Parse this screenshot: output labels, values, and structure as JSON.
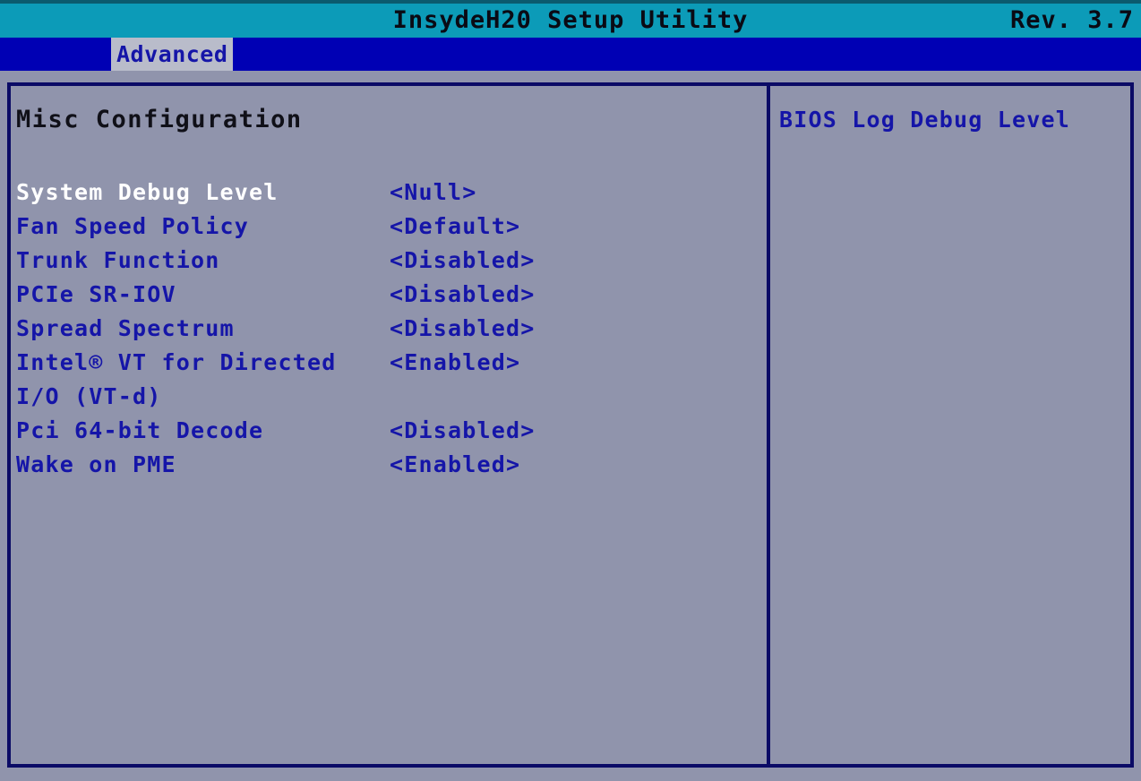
{
  "window": {
    "title": "InsydeH20 Setup Utility",
    "revision": "Rev. 3.7"
  },
  "colors": {
    "title_bar": "#0c9bb8",
    "menu_bar": "#0000b4",
    "panel_background": "#9094ac",
    "frame_border": "#0b0b66",
    "text_blue": "#1515a8",
    "text_black": "#101018",
    "text_highlight": "#ffffff",
    "tab_selected_background": "#b9bcca"
  },
  "menu": {
    "items": [
      {
        "label": "Advanced",
        "selected": true
      }
    ]
  },
  "main": {
    "section_title": "Misc Configuration",
    "settings": [
      {
        "label": "System Debug Level",
        "value": "<Null>",
        "highlighted": true
      },
      {
        "label": "Fan Speed Policy",
        "value": "<Default>",
        "highlighted": false
      },
      {
        "label": "Trunk Function",
        "value": "<Disabled>",
        "highlighted": false
      },
      {
        "label": "PCIe SR-IOV",
        "value": "<Disabled>",
        "highlighted": false
      },
      {
        "label": "Spread Spectrum",
        "value": "<Disabled>",
        "highlighted": false
      },
      {
        "label": "Intel® VT for Directed",
        "value": "<Enabled>",
        "highlighted": false
      },
      {
        "label": "I/O (VT-d)",
        "value": "",
        "highlighted": false,
        "continuation": true
      },
      {
        "label": "Pci 64-bit Decode",
        "value": "<Disabled>",
        "highlighted": false
      },
      {
        "label": "Wake on PME",
        "value": "<Enabled>",
        "highlighted": false
      }
    ]
  },
  "help": {
    "text": "BIOS Log Debug Level"
  }
}
